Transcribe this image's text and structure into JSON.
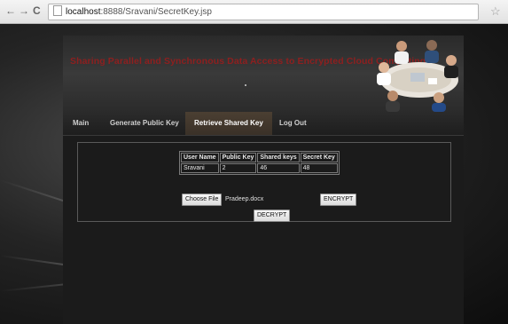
{
  "browser": {
    "url_host": "localhost",
    "url_path": ":8888/Sravani/SecretKey.jsp",
    "back_glyph": "←",
    "forward_glyph": "→",
    "reload_glyph": "C",
    "star_glyph": "☆"
  },
  "site": {
    "title": "Sharing Parallel and Synchronous Data Access to Encrypted Cloud Computing"
  },
  "nav": {
    "items": [
      {
        "label": "Main"
      },
      {
        "label": "Generate Public Key"
      },
      {
        "label": "Retrieve Shared Key"
      },
      {
        "label": "Log Out"
      }
    ],
    "active": "Retrieve Shared Key"
  },
  "keys_table": {
    "headers": [
      "User Name",
      "Public Key",
      "Shared keys",
      "Secret Key"
    ],
    "rows": [
      [
        "Sravani",
        "2",
        "46",
        "48"
      ]
    ]
  },
  "file": {
    "choose_label": "Choose File",
    "selected_name": "Pradeep.docx"
  },
  "actions": {
    "encrypt_label": "ENCRYPT",
    "decrypt_label": "DECRYPT"
  }
}
